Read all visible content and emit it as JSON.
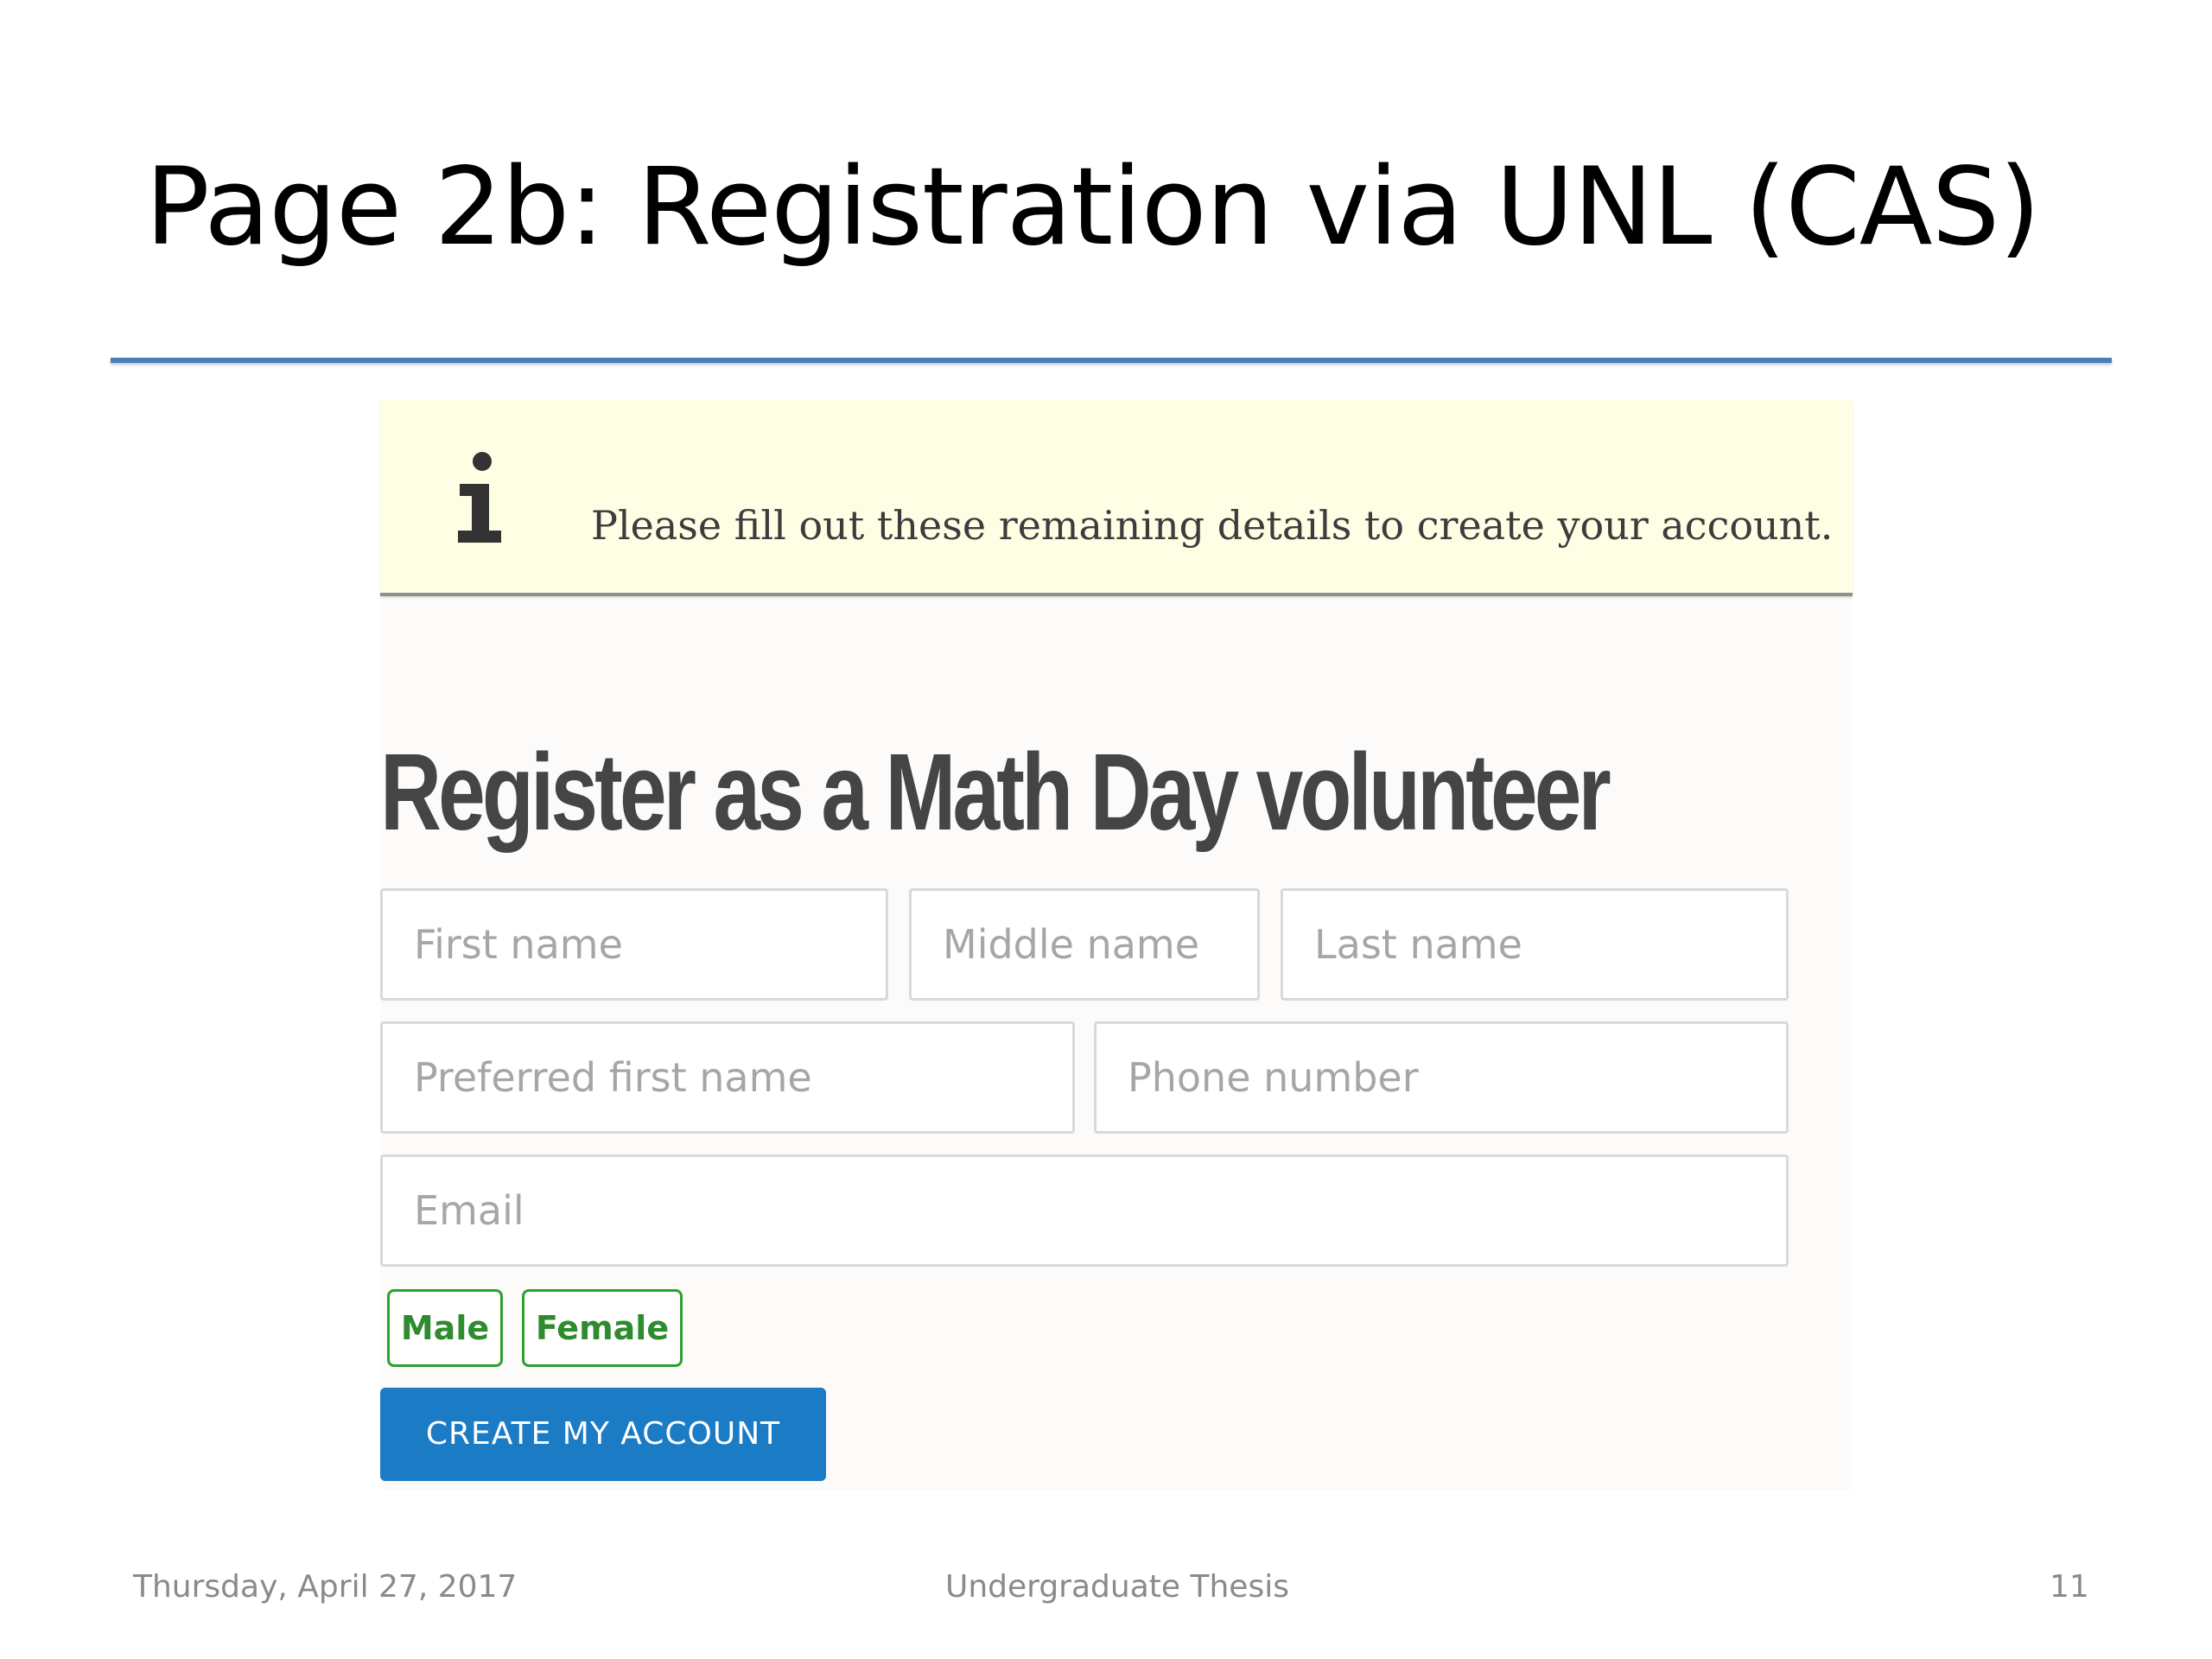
{
  "slide": {
    "title": "Page 2b: Registration via UNL (CAS)",
    "title_rule_color": "#4a7ebb"
  },
  "notice": {
    "icon": "info-icon",
    "text": "Please fill out these remaining details to create your account.",
    "background": "#fefee4"
  },
  "form": {
    "heading": "Register as a Math Day volunteer",
    "fields": {
      "first_name": {
        "placeholder": "First name",
        "value": ""
      },
      "middle_name": {
        "placeholder": "Middle name",
        "value": ""
      },
      "last_name": {
        "placeholder": "Last name",
        "value": ""
      },
      "preferred_first_name": {
        "placeholder": "Preferred first name",
        "value": ""
      },
      "phone_number": {
        "placeholder": "Phone number",
        "value": ""
      },
      "email": {
        "placeholder": "Email",
        "value": ""
      }
    },
    "gender_options": {
      "male": "Male",
      "female": "Female"
    },
    "gender_color": "#2ea02e",
    "submit_label": "CREATE MY ACCOUNT",
    "submit_color": "#1b7bc4"
  },
  "footer": {
    "date": "Thursday, April 27, 2017",
    "center": "Undergraduate Thesis",
    "page_number": "11"
  }
}
